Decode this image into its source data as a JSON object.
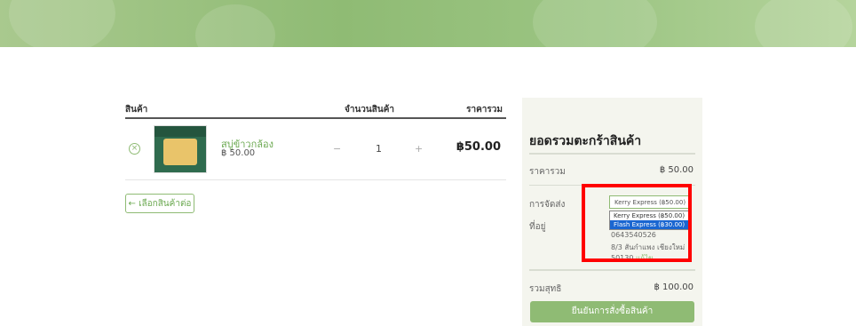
{
  "cart": {
    "headers": {
      "product": "สินค้า",
      "quantity": "จำนวนสินค้า",
      "total": "ราคารวม"
    },
    "items": [
      {
        "name": "สบู่ข้าวกล้อง",
        "price": "฿ 50.00",
        "quantity": "1",
        "minus": "−",
        "plus": "+",
        "total": "฿50.00",
        "remove_icon": "×"
      }
    ],
    "continue_label": "← เลือกสินค้าต่อ"
  },
  "summary": {
    "title": "ยอดรวมตะกร้าสินค้า",
    "subtotal_label": "ราคารวม",
    "subtotal_value": "฿ 50.00",
    "shipping_label": "การจัดส่ง",
    "shipping_selected": "Kerry Express (฿50.00)",
    "shipping_options": [
      "Kerry Express (฿50.00)",
      "Flash Express (฿30.00)"
    ],
    "address_label": "ที่อยู่",
    "address_phone": "0643540526",
    "address_line1": "8/3 สันกำแพง เชียงใหม่",
    "address_postcode": "50130",
    "address_edit": "แก้ไข",
    "grand_total_label": "รวมสุทธิ",
    "grand_total_value": "฿ 100.00",
    "confirm_label": "ยืนยันการสั่งซื้อสินค้า"
  },
  "colors": {
    "accent": "#8fbb74",
    "highlight": "#ff0000",
    "selected_option": "#1a66d1"
  }
}
